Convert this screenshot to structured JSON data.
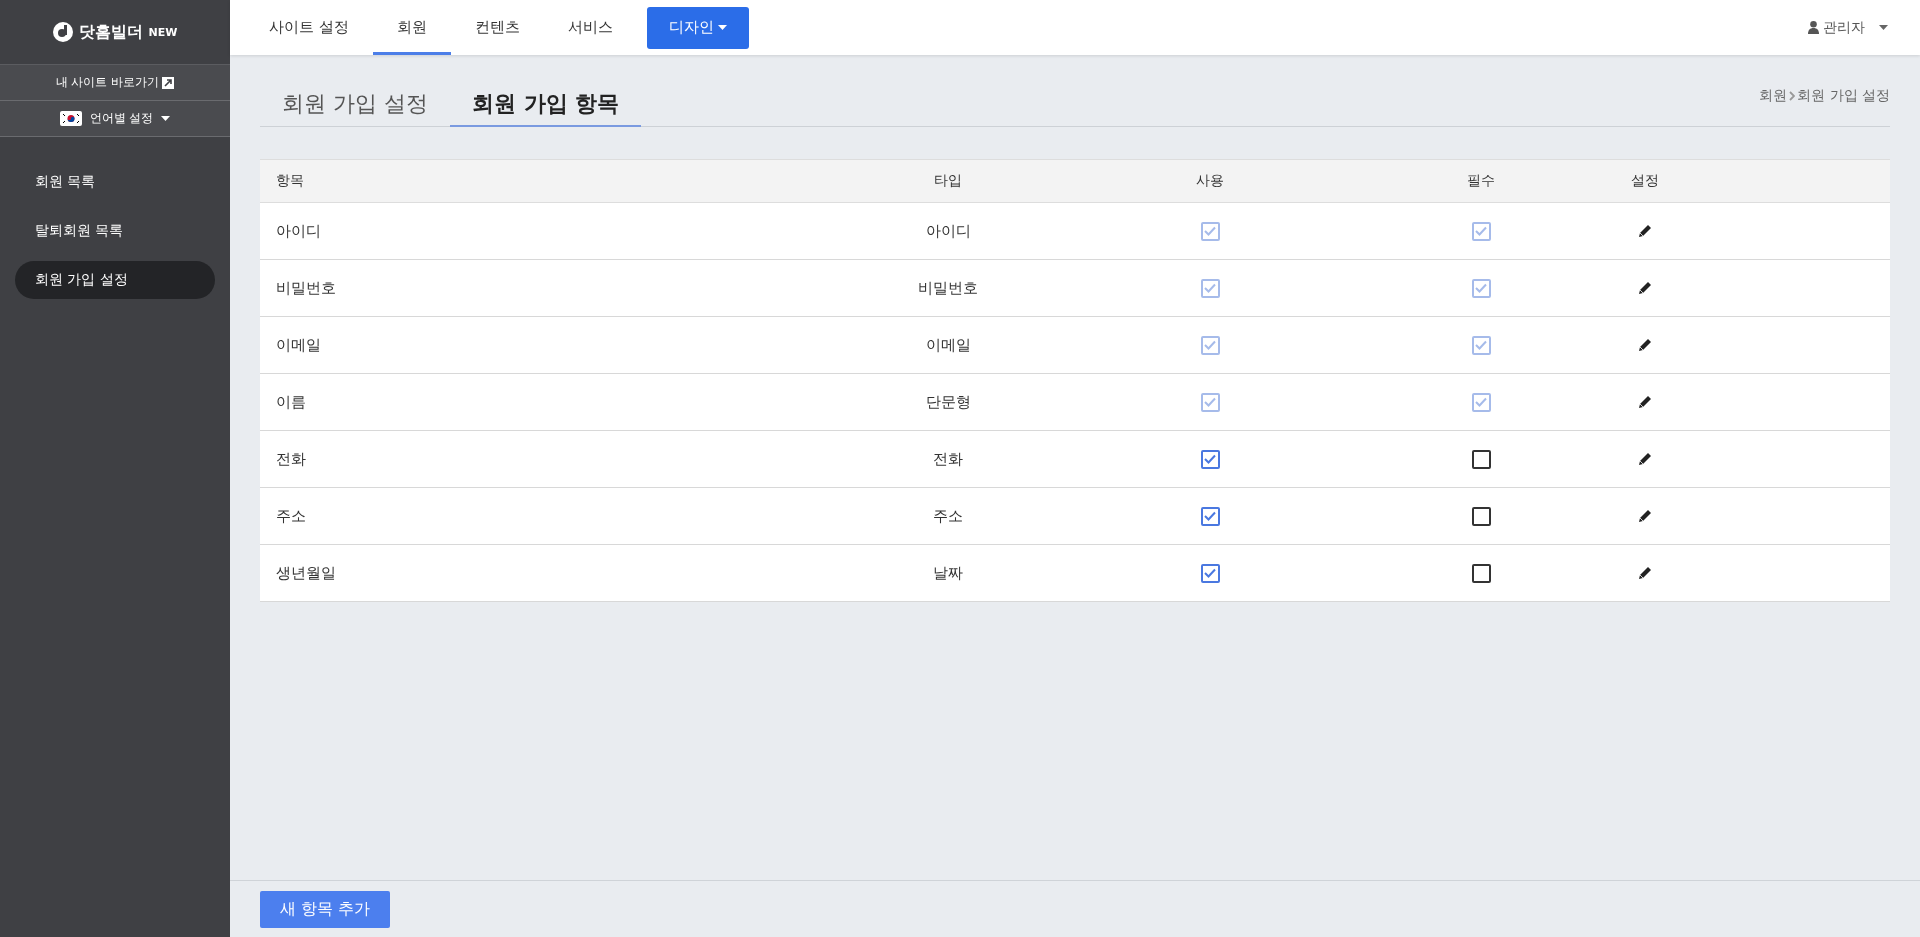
{
  "sidebar": {
    "logo": {
      "name": "닷홈빌더",
      "badge": "NEW"
    },
    "site_link": "내 사이트 바로가기",
    "language": "언어별 설정",
    "items": [
      {
        "label": "회원 목록",
        "selected": false
      },
      {
        "label": "탈퇴회원 목록",
        "selected": false
      },
      {
        "label": "회원 가입 설정",
        "selected": true
      }
    ]
  },
  "top_nav": {
    "items": [
      {
        "label": "사이트 설정",
        "selected": false,
        "kind": "link"
      },
      {
        "label": "회원",
        "selected": true,
        "kind": "link"
      },
      {
        "label": "컨텐츠",
        "selected": false,
        "kind": "link"
      },
      {
        "label": "서비스",
        "selected": false,
        "kind": "link"
      },
      {
        "label": "디자인",
        "selected": false,
        "kind": "dropdown"
      }
    ],
    "user": "관리자"
  },
  "tabs": [
    {
      "label": "회원 가입 설정",
      "selected": false
    },
    {
      "label": "회원 가입 항목",
      "selected": true
    }
  ],
  "breadcrumb": [
    "회원",
    "회원 가입 설정"
  ],
  "table": {
    "columns": [
      "항목",
      "타입",
      "사용",
      "필수",
      "설정"
    ],
    "rows": [
      {
        "item": "아이디",
        "type": "아이디",
        "use": {
          "checked": true,
          "disabled": true
        },
        "required": {
          "checked": true,
          "disabled": true
        }
      },
      {
        "item": "비밀번호",
        "type": "비밀번호",
        "use": {
          "checked": true,
          "disabled": true
        },
        "required": {
          "checked": true,
          "disabled": true
        }
      },
      {
        "item": "이메일",
        "type": "이메일",
        "use": {
          "checked": true,
          "disabled": true
        },
        "required": {
          "checked": true,
          "disabled": true
        }
      },
      {
        "item": "이름",
        "type": "단문형",
        "use": {
          "checked": true,
          "disabled": true
        },
        "required": {
          "checked": true,
          "disabled": true
        }
      },
      {
        "item": "전화",
        "type": "전화",
        "use": {
          "checked": true,
          "disabled": false
        },
        "required": {
          "checked": false,
          "disabled": false
        }
      },
      {
        "item": "주소",
        "type": "주소",
        "use": {
          "checked": true,
          "disabled": false
        },
        "required": {
          "checked": false,
          "disabled": false
        }
      },
      {
        "item": "생년월일",
        "type": "날짜",
        "use": {
          "checked": true,
          "disabled": false
        },
        "required": {
          "checked": false,
          "disabled": false
        }
      }
    ]
  },
  "add_button": "새 항목 추가"
}
